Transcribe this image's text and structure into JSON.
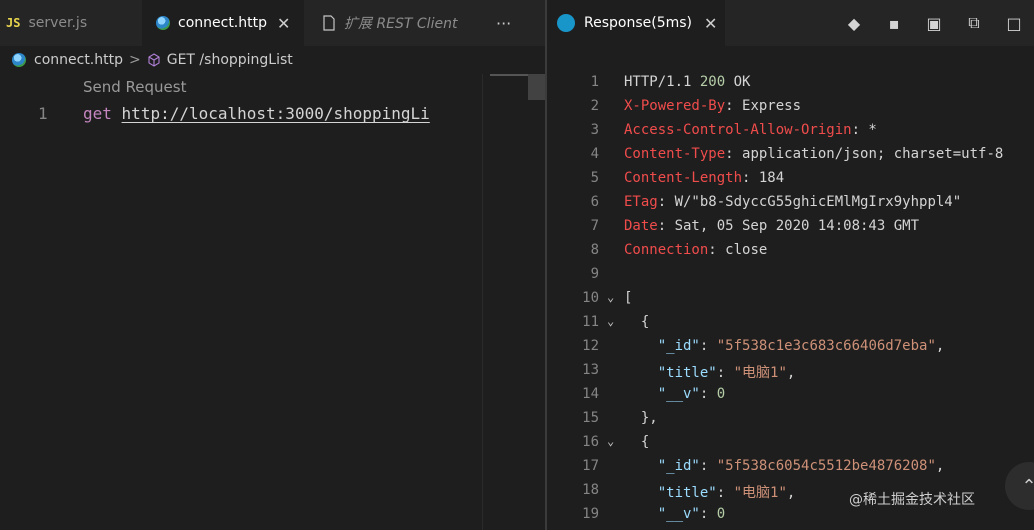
{
  "left": {
    "tabs": [
      {
        "badge": "JS",
        "label": "server.js"
      },
      {
        "label": "connect.http",
        "close": "✕"
      },
      {
        "label": "扩展 REST Client"
      }
    ],
    "more": "···",
    "breadcrumb": {
      "file": "connect.http",
      "sep": ">",
      "request": "GET /shoppingList"
    },
    "codelens": "Send Request",
    "line_number": "1",
    "code": {
      "method": "get",
      "url": "http://localhost:3000/shoppingLi"
    }
  },
  "right": {
    "tab": {
      "label": "Response(5ms)",
      "close": "✕"
    },
    "actions": [
      "◆",
      "▪",
      "▣",
      "⧉",
      "□"
    ],
    "lines": [
      {
        "n": "1",
        "html": "HTTP/1.1 <span class='num'>200</span> OK"
      },
      {
        "n": "2",
        "html": "<span class='hkey'>X-Powered-By</span>: Express"
      },
      {
        "n": "3",
        "html": "<span class='hkey'>Access-Control-Allow-Origin</span>: *"
      },
      {
        "n": "4",
        "html": "<span class='hkey'>Content-Type</span>: application/json; charset=utf-8"
      },
      {
        "n": "5",
        "html": "<span class='hkey'>Content-Length</span>: 184"
      },
      {
        "n": "6",
        "html": "<span class='hkey'>ETag</span>: W/\"b8-SdyccG55ghicEMlMgIrx9yhppl4\""
      },
      {
        "n": "7",
        "html": "<span class='hkey'>Date</span>: Sat, 05 Sep 2020 14:08:43 GMT"
      },
      {
        "n": "8",
        "html": "<span class='hkey'>Connection</span>: close"
      },
      {
        "n": "9",
        "html": ""
      },
      {
        "n": "10",
        "fold": "⌄",
        "html": "["
      },
      {
        "n": "11",
        "fold": "⌄",
        "html": "  {"
      },
      {
        "n": "12",
        "html": "    <span class='key'>\"_id\"</span>: <span class='str'>\"5f538c1e3c683c66406d7eba\"</span>,"
      },
      {
        "n": "13",
        "html": "    <span class='key'>\"title\"</span>: <span class='str'>\"电脑1\"</span>,"
      },
      {
        "n": "14",
        "html": "    <span class='key'>\"__v\"</span>: <span class='num'>0</span>"
      },
      {
        "n": "15",
        "html": "  },"
      },
      {
        "n": "16",
        "fold": "⌄",
        "html": "  {"
      },
      {
        "n": "17",
        "html": "    <span class='key'>\"_id\"</span>: <span class='str'>\"5f538c6054c5512be4876208\"</span>,"
      },
      {
        "n": "18",
        "html": "    <span class='key'>\"title\"</span>: <span class='str'>\"电脑1\"</span>,"
      },
      {
        "n": "19",
        "html": "    <span class='key'>\"__v\"</span>: <span class='num'>0</span>"
      }
    ],
    "scroll_top_icon": "⌃",
    "watermark": "@稀土掘金技术社区"
  }
}
